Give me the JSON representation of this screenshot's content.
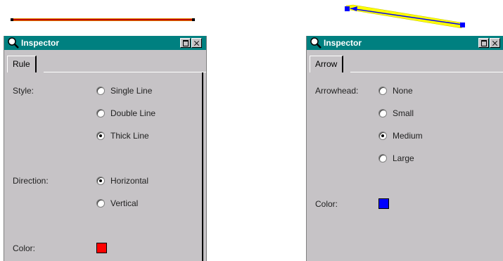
{
  "demo": {
    "rule_color": "#c00000",
    "rule_outline": "#e08000",
    "arrow_color": "#0000ff",
    "arrow_highlight": "#ffff00"
  },
  "rule_inspector": {
    "title": "Inspector",
    "tab": "Rule",
    "style_label": "Style:",
    "style_options": [
      "Single Line",
      "Double Line",
      "Thick Line"
    ],
    "style_selected": "Thick Line",
    "direction_label": "Direction:",
    "direction_options": [
      "Horizontal",
      "Vertical"
    ],
    "direction_selected": "Horizontal",
    "color_label": "Color:",
    "color": "#ff0000"
  },
  "arrow_inspector": {
    "title": "Inspector",
    "tab": "Arrow",
    "arrowhead_label": "Arrowhead:",
    "arrowhead_options": [
      "None",
      "Small",
      "Medium",
      "Large"
    ],
    "arrowhead_selected": "Medium",
    "color_label": "Color:",
    "color": "#0000ff"
  },
  "icons": {
    "title_icon": "magnifier-icon",
    "maximize": "maximize-icon",
    "close": "close-icon"
  }
}
